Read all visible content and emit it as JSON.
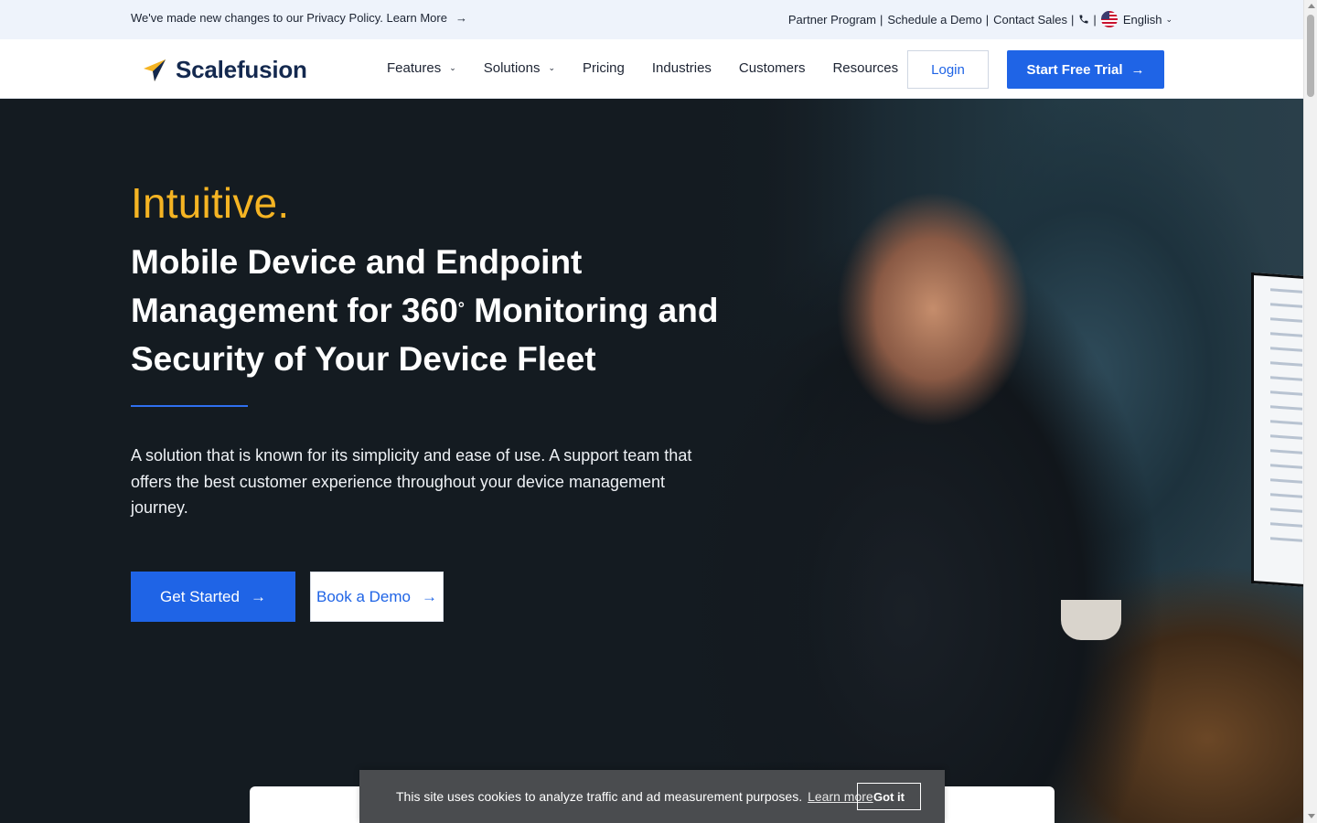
{
  "topbar": {
    "notice": "We've made new changes to our Privacy Policy. Learn More",
    "links": [
      "Partner Program",
      "Schedule a Demo",
      "Contact Sales"
    ],
    "language": "English"
  },
  "header": {
    "brand": "Scalefusion",
    "nav": [
      "Features",
      "Solutions",
      "Pricing",
      "Industries",
      "Customers",
      "Resources"
    ],
    "login": "Login",
    "trial": "Start Free Trial"
  },
  "hero": {
    "kicker": "Intuitive.",
    "title_part1": "Mobile Device and Endpoint Management for 360",
    "title_degree": "°",
    "title_part2": " Monitoring and Security of Your Device Fleet",
    "description": "A solution that is known for its simplicity and ease of use. A support team that offers the best customer experience throughout your device management journey.",
    "cta_primary": "Get Started",
    "cta_secondary": "Book a Demo"
  },
  "cookie": {
    "message": "This site uses cookies to analyze traffic and ad measurement purposes.",
    "learn": "Learn more",
    "accept": "Got it"
  },
  "colors": {
    "accent_blue": "#1f64e6",
    "kicker_yellow": "#f5b423",
    "hero_bg": "#141b21",
    "topbar_bg": "#eef3fb",
    "cookie_bg": "#4a4c4f"
  }
}
